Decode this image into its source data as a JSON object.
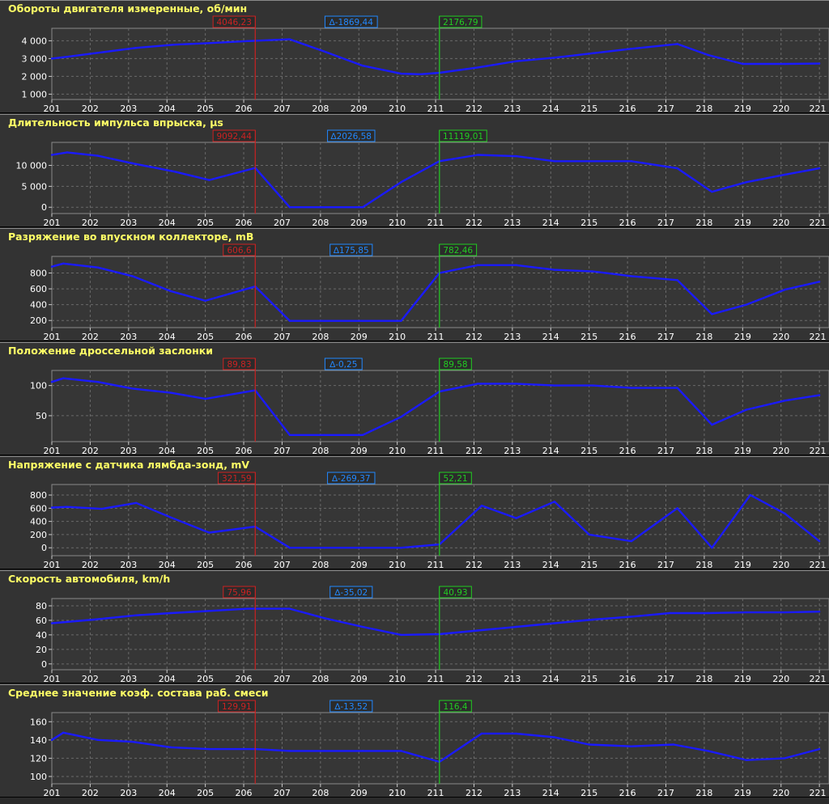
{
  "colors": {
    "line": "#1a1aff",
    "cursor_left": "#cc2222",
    "cursor_right": "#22cc22",
    "delta": "#2288ff",
    "title": "#ffff66",
    "plot_bg": "#363636",
    "grid": "#6a6a6a",
    "text": "#ffffff"
  },
  "chart_data": [
    {
      "type": "line",
      "title": "Обороты двигателя измеренные, об/мин",
      "x": [
        201,
        201.4,
        202.3,
        203.2,
        204.2,
        205.1,
        206.1,
        207.2,
        208.1,
        209.1,
        210.1,
        210.6,
        211.1,
        212.1,
        213.1,
        214.1,
        215.1,
        216.1,
        217.3,
        218.1,
        219.0,
        220.1,
        221.0
      ],
      "values": [
        3000,
        3100,
        3350,
        3600,
        3780,
        3870,
        3980,
        4080,
        3400,
        2600,
        2150,
        2120,
        2200,
        2500,
        2850,
        3050,
        3300,
        3550,
        3820,
        3200,
        2700,
        2700,
        2720
      ],
      "yticks": [
        1000,
        2000,
        3000,
        4000
      ],
      "ytick_labels": [
        "1 000",
        "2 000",
        "3 000",
        "4 000"
      ],
      "ylim": [
        700,
        4700
      ],
      "cursor_left": {
        "x": 206.3,
        "label": "4046,23"
      },
      "cursor_right": {
        "x": 211.1,
        "label": "2176,79"
      },
      "delta": {
        "label": "∆-1869,44",
        "x": 208.8
      }
    },
    {
      "type": "line",
      "title": "Длительность импульса впрыска, μs",
      "x": [
        201,
        201.4,
        202.2,
        203.1,
        204.2,
        205.1,
        206.3,
        207.2,
        208.1,
        209.1,
        210.1,
        211.1,
        212.1,
        213.1,
        214.1,
        215.0,
        216.1,
        217.3,
        218.2,
        219.1,
        220.1,
        221.0
      ],
      "values": [
        12500,
        13100,
        12300,
        10500,
        8500,
        6500,
        9400,
        0,
        0,
        0,
        6000,
        11000,
        12500,
        12200,
        11000,
        11000,
        11000,
        9300,
        3700,
        6000,
        7800,
        9300
      ],
      "yticks": [
        0,
        5000,
        10000
      ],
      "ytick_labels": [
        "0",
        "5 000",
        "10 000"
      ],
      "ylim": [
        -1500,
        15500
      ],
      "cursor_left": {
        "x": 206.3,
        "label": "9092,44"
      },
      "cursor_right": {
        "x": 211.1,
        "label": "11119,01"
      },
      "delta": {
        "label": "∆2026,58",
        "x": 208.8
      }
    },
    {
      "type": "line",
      "title": "Разряжение во впускном коллекторе, mB",
      "x": [
        201,
        201.3,
        202.2,
        203.1,
        204.1,
        205.0,
        206.3,
        207.2,
        208.1,
        209.1,
        210.1,
        211.1,
        212.1,
        213.1,
        214.1,
        215.1,
        216.1,
        217.3,
        218.2,
        219.1,
        220.1,
        221.0
      ],
      "values": [
        880,
        920,
        870,
        760,
        570,
        450,
        630,
        195,
        195,
        195,
        195,
        800,
        900,
        900,
        840,
        820,
        760,
        710,
        280,
        400,
        590,
        690
      ],
      "yticks": [
        200,
        400,
        600,
        800
      ],
      "ytick_labels": [
        "200",
        "400",
        "600",
        "800"
      ],
      "ylim": [
        110,
        1010
      ],
      "cursor_left": {
        "x": 206.3,
        "label": "606,6"
      },
      "cursor_right": {
        "x": 211.1,
        "label": "782,46"
      },
      "delta": {
        "label": "∆175,85",
        "x": 208.8
      }
    },
    {
      "type": "line",
      "title": "Положение дроссельной заслонки",
      "x": [
        201,
        201.3,
        202.2,
        203.1,
        204.1,
        205.0,
        206.3,
        207.2,
        208.1,
        209.1,
        210.1,
        211.1,
        212.1,
        213.1,
        214.1,
        215.1,
        216.1,
        217.3,
        218.2,
        219.1,
        220.1,
        221.0
      ],
      "values": [
        106,
        112,
        106,
        95,
        88,
        78,
        92,
        18,
        18,
        18,
        48,
        90,
        103,
        103,
        100,
        100,
        96,
        96,
        35,
        60,
        75,
        84
      ],
      "yticks": [
        50,
        100
      ],
      "ytick_labels": [
        "50",
        "100"
      ],
      "ylim": [
        7,
        125
      ],
      "cursor_left": {
        "x": 206.3,
        "label": "89,83"
      },
      "cursor_right": {
        "x": 211.1,
        "label": "89,58"
      },
      "delta": {
        "label": "∆-0,25",
        "x": 208.6
      }
    },
    {
      "type": "line",
      "title": "Напряжение с датчика лямбда-зонд, mV",
      "x": [
        201,
        201.4,
        202.3,
        203.2,
        204.1,
        205.1,
        206.3,
        207.2,
        208.1,
        209.1,
        210.1,
        211.1,
        212.2,
        213.1,
        214.1,
        215.0,
        216.1,
        217.3,
        218.2,
        219.2,
        220.1,
        221.0
      ],
      "values": [
        610,
        620,
        590,
        680,
        460,
        230,
        320,
        0,
        0,
        0,
        0,
        50,
        640,
        450,
        700,
        200,
        100,
        600,
        0,
        800,
        520,
        100
      ],
      "yticks": [
        0,
        200,
        400,
        600,
        800
      ],
      "ytick_labels": [
        "0",
        "200",
        "400",
        "600",
        "800"
      ],
      "ylim": [
        -120,
        960
      ],
      "cursor_left": {
        "x": 206.3,
        "label": "321,59"
      },
      "cursor_right": {
        "x": 211.1,
        "label": "52,21"
      },
      "delta": {
        "label": "∆-269,37",
        "x": 208.8
      }
    },
    {
      "type": "line",
      "title": "Скорость автомобиля, km/h",
      "x": [
        201,
        202.1,
        203.2,
        204.1,
        205.1,
        206.1,
        207.2,
        208.1,
        209.1,
        210.1,
        211.1,
        212.1,
        213.1,
        214.1,
        215.1,
        216.1,
        217.1,
        218.1,
        219.1,
        220.1,
        221.0
      ],
      "values": [
        56,
        61,
        67,
        70,
        73,
        76,
        76,
        63,
        51,
        40,
        41,
        46,
        51,
        56,
        61,
        65,
        70,
        70,
        71,
        71,
        72
      ],
      "yticks": [
        0,
        20,
        40,
        60,
        80
      ],
      "ytick_labels": [
        "0",
        "20",
        "40",
        "60",
        "80"
      ],
      "ylim": [
        -8,
        90
      ],
      "cursor_left": {
        "x": 206.3,
        "label": "75,96"
      },
      "cursor_right": {
        "x": 211.1,
        "label": "40,93"
      },
      "delta": {
        "label": "∆-35,02",
        "x": 208.8
      }
    },
    {
      "type": "line",
      "title": "Среднее значение коэф. состава раб. смеси",
      "x": [
        201,
        201.3,
        202.2,
        203.1,
        204.1,
        205.1,
        206.3,
        207.2,
        208.1,
        209.1,
        210.1,
        211.1,
        212.2,
        213.1,
        214.1,
        215.0,
        216.1,
        217.2,
        218.1,
        219.1,
        220.1,
        221.0
      ],
      "values": [
        140,
        148,
        140,
        138,
        132,
        130,
        130,
        128,
        128,
        128,
        128,
        116,
        147,
        147,
        143,
        135,
        133,
        135,
        128,
        118,
        120,
        130
      ],
      "yticks": [
        100,
        120,
        140,
        160
      ],
      "ytick_labels": [
        "100",
        "120",
        "140",
        "160"
      ],
      "ylim": [
        92,
        170
      ],
      "cursor_left": {
        "x": 206.3,
        "label": "129,91"
      },
      "cursor_right": {
        "x": 211.1,
        "label": "116,4"
      },
      "delta": {
        "label": "∆-13,52",
        "x": 208.8
      }
    }
  ],
  "x_axis": {
    "ticks": [
      201,
      202,
      203,
      204,
      205,
      206,
      207,
      208,
      209,
      210,
      211,
      212,
      213,
      214,
      215,
      216,
      217,
      218,
      219,
      220,
      221
    ],
    "xlim": [
      201,
      221.25
    ]
  }
}
